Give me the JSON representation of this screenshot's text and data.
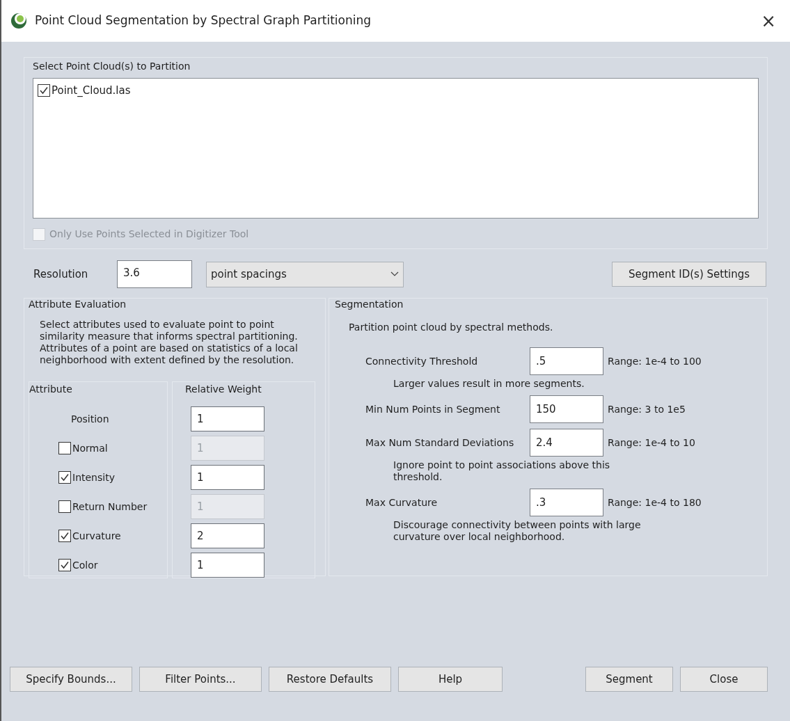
{
  "window": {
    "title": "Point Cloud Segmentation by Spectral Graph Partitioning",
    "close": "×"
  },
  "point_cloud_list": {
    "label": "Select Point Cloud(s) to Partition",
    "items": [
      {
        "label": "Point_Cloud.las",
        "checked": true
      }
    ]
  },
  "digitizer_option": {
    "label": "Only Use Points Selected in Digitizer Tool",
    "checked": false,
    "disabled": true
  },
  "resolution": {
    "label": "Resolution",
    "value": "3.6",
    "units": "point spacings"
  },
  "segment_id_button": "Segment ID(s) Settings",
  "attribute_evaluation": {
    "title": "Attribute Evaluation",
    "description": "Select attributes used to evaluate point to point similarity measure that informs spectral partitioning. Attributes of a point are based on statistics of a local neighborhood with extent defined by the resolution.",
    "attribute_header": "Attribute",
    "weight_header": "Relative Weight",
    "attributes": [
      {
        "kind": "fixed",
        "label": "Position",
        "weight": "1"
      },
      {
        "kind": "checkbox",
        "label": "Normal",
        "checked": false,
        "weight": "1"
      },
      {
        "kind": "checkbox",
        "label": "Intensity",
        "checked": true,
        "weight": "1"
      },
      {
        "kind": "checkbox",
        "label": "Return Number",
        "checked": false,
        "weight": "1"
      },
      {
        "kind": "checkbox",
        "label": "Curvature",
        "checked": true,
        "weight": "2"
      },
      {
        "kind": "checkbox",
        "label": "Color",
        "checked": true,
        "weight": "1"
      }
    ]
  },
  "segmentation": {
    "title": "Segmentation",
    "description": "Partition point cloud by spectral methods.",
    "parameters": [
      {
        "label": "Connectivity Threshold",
        "value": ".5",
        "range": "Range: 1e-4 to 100",
        "note": "Larger values result in more segments."
      },
      {
        "label": "Min Num Points in Segment",
        "value": "150",
        "range": "Range: 3 to 1e5"
      },
      {
        "label": "Max Num Standard Deviations",
        "value": "2.4",
        "range": "Range: 1e-4 to 10",
        "note": "Ignore point to point associations above this threshold."
      },
      {
        "label": "Max Curvature",
        "value": ".3",
        "range": "Range: 1e-4 to 180",
        "note": "Discourage connectivity between points with large curvature over local neighborhood."
      }
    ]
  },
  "buttons_left": [
    "Specify Bounds...",
    "Filter Points...",
    "Restore Defaults",
    "Help"
  ],
  "buttons_right": [
    "Segment",
    "Close"
  ]
}
